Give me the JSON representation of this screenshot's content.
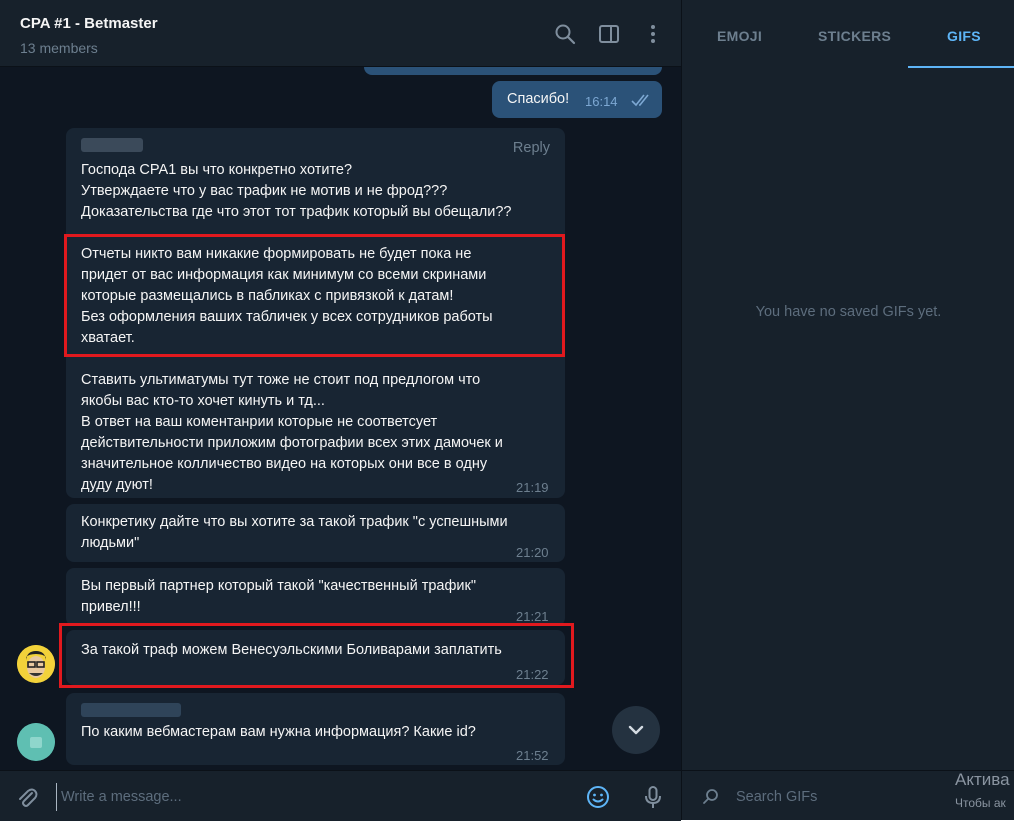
{
  "chat": {
    "title": "CPA #1 - Betmaster",
    "members": "13 members"
  },
  "messages": {
    "outgoing_thanks": {
      "text": "Спасибо!",
      "time": "16:14"
    },
    "block1": {
      "reply_label": "Reply",
      "para1": "Господа СРА1 вы что конкретно хотите?\nУтверждаете что у вас трафик не мотив и не фрод???\nДоказательства где что этот тот трафик который вы обещали??",
      "para2": "Отчеты никто вам никакие формировать не будет пока не\nпридет от вас информация как минимум со всеми скринами\nкоторые размещались в пабликах с привязкой к датам!\nБез оформления ваших  табличек у всех сотрудников работы\nхватает.",
      "para3": "Ставить ультиматумы тут тоже не стоит под предлогом что\nякобы вас кто-то хочет кинуть и тд...\nВ ответ на ваш коментанрии которые не соответсует\nдействительности приложим фотографии всех этих дамочек и\nзначительное колличество видео на которых они все в одну\nдуду дуют!",
      "time": "21:19"
    },
    "msg2": {
      "text": "Конкретику дайте что вы хотите за такой трафик \"с успешными\nлюдьми\"",
      "time": "21:20"
    },
    "msg3": {
      "text": "Вы первый партнер который такой \"качественный трафик\"\nпривел!!!",
      "time": "21:21"
    },
    "msg4": {
      "text": "За такой траф можем Венесуэльскими Боливарами заплатить",
      "time": "21:22"
    },
    "msg5": {
      "text": "По каким вебмастерам вам нужна информация? Какие id?",
      "time": "21:52"
    }
  },
  "composer": {
    "placeholder": "Write a message..."
  },
  "panel": {
    "tabs": [
      "EMOJI",
      "STICKERS",
      "GIFS"
    ],
    "active_tab": "GIFS",
    "empty_text": "You have no saved GIFs yet.",
    "search_placeholder": "Search GIFs"
  },
  "watermark": {
    "line1": "Актива",
    "line2": "Чтобы ак"
  },
  "colors": {
    "chat_bg": "#0e1621",
    "header_bg": "#17212b",
    "incoming_bubble": "#182533",
    "outgoing_bubble": "#2b5278",
    "accent": "#5eb5f7",
    "highlight": "#e1191e"
  },
  "icons": {
    "header": [
      "search-icon",
      "sidebar-toggle-icon",
      "more-vertical-icon"
    ],
    "composer": [
      "paperclip-icon",
      "emoji-smile-icon",
      "microphone-icon"
    ],
    "misc": [
      "double-check-icon",
      "chevron-down-icon",
      "gif-search-icon"
    ]
  }
}
